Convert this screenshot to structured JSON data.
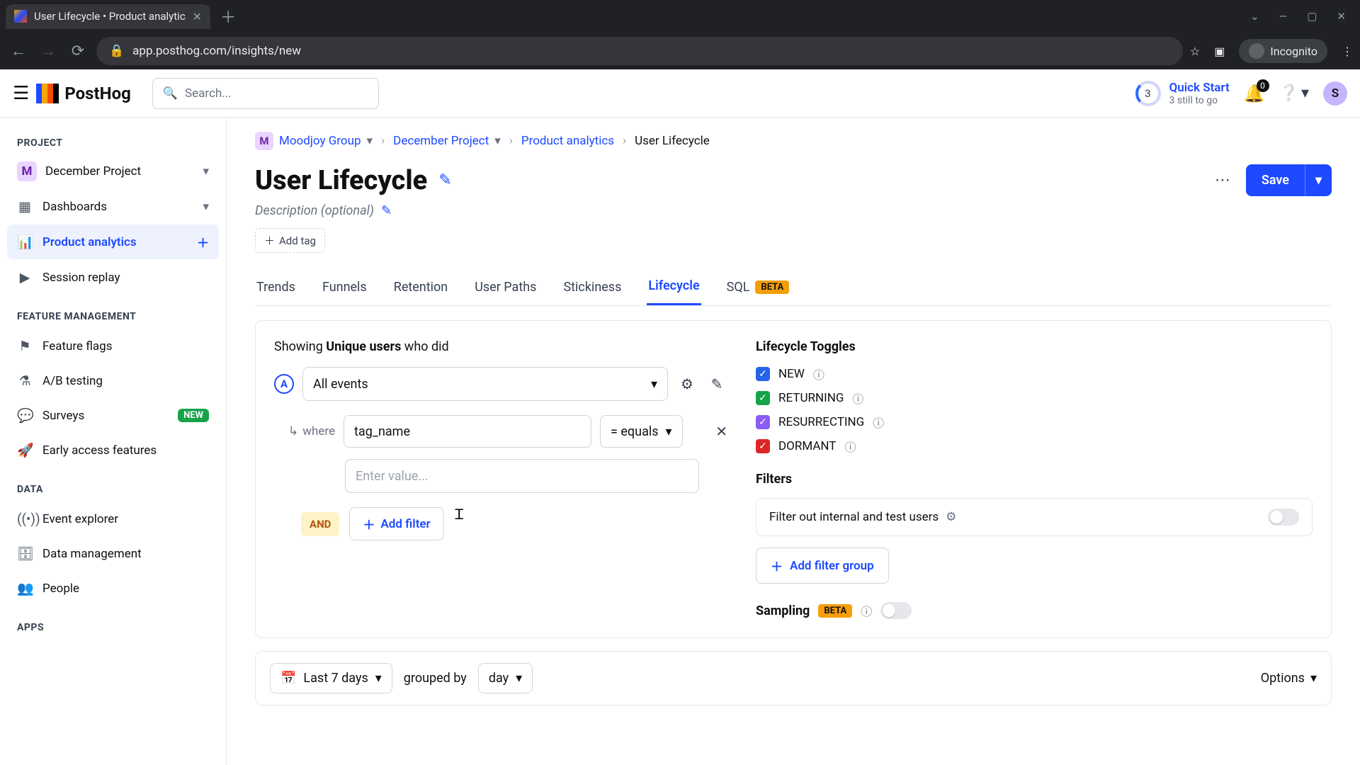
{
  "browser": {
    "tab_title": "User Lifecycle • Product analytic",
    "url": "app.posthog.com/insights/new",
    "incognito_label": "Incognito"
  },
  "topbar": {
    "search_placeholder": "Search...",
    "quick_start": {
      "badge": "3",
      "title": "Quick Start",
      "subtitle": "3 still to go"
    },
    "notif_count": "0",
    "avatar_letter": "S",
    "logo_text": "PostHog"
  },
  "sidebar": {
    "sections": {
      "project": "PROJECT",
      "feature": "FEATURE MANAGEMENT",
      "data": "DATA",
      "apps": "APPS"
    },
    "project_name": "December Project",
    "items": {
      "dashboards": "Dashboards",
      "product_analytics": "Product analytics",
      "session_replay": "Session replay",
      "feature_flags": "Feature flags",
      "ab_testing": "A/B testing",
      "surveys": "Surveys",
      "surveys_badge": "NEW",
      "early_access": "Early access features",
      "event_explorer": "Event explorer",
      "data_mgmt": "Data management",
      "people": "People"
    }
  },
  "breadcrumb": {
    "org": "Moodjoy Group",
    "project": "December Project",
    "section": "Product analytics",
    "current": "User Lifecycle"
  },
  "page": {
    "title": "User Lifecycle",
    "description_placeholder": "Description (optional)",
    "add_tag": "Add tag",
    "save": "Save"
  },
  "tabs": {
    "trends": "Trends",
    "funnels": "Funnels",
    "retention": "Retention",
    "paths": "User Paths",
    "stickiness": "Stickiness",
    "lifecycle": "Lifecycle",
    "sql": "SQL",
    "beta": "BETA"
  },
  "query": {
    "showing_pre": "Showing ",
    "showing_bold": "Unique users",
    "showing_post": " who did",
    "series_letter": "A",
    "event_label": "All events",
    "where_label": "where",
    "property": "tag_name",
    "operator": "= equals",
    "value_placeholder": "Enter value...",
    "and_label": "AND",
    "add_filter": "Add filter"
  },
  "lifecycle_toggles": {
    "heading": "Lifecycle Toggles",
    "new": "NEW",
    "returning": "RETURNING",
    "resurrecting": "RESURRECTING",
    "dormant": "DORMANT"
  },
  "filters": {
    "heading": "Filters",
    "internal_label": "Filter out internal and test users",
    "add_group": "Add filter group"
  },
  "sampling": {
    "label": "Sampling",
    "beta": "BETA"
  },
  "bottombar": {
    "range": "Last 7 days",
    "grouped": "grouped by",
    "interval": "day",
    "options": "Options"
  }
}
